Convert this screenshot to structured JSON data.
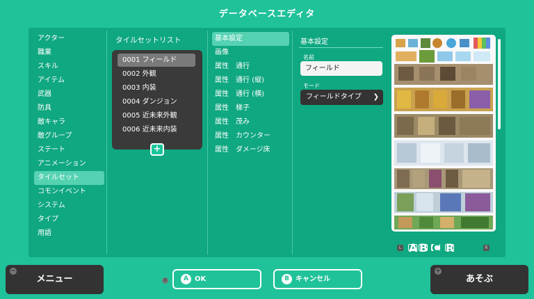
{
  "header": {
    "title": "データベースエディタ"
  },
  "categories": [
    "アクター",
    "職業",
    "スキル",
    "アイテム",
    "武器",
    "防具",
    "敵キャラ",
    "敵グループ",
    "ステート",
    "アニメーション",
    "タイルセット",
    "コモンイベント",
    "システム",
    "タイプ",
    "用語"
  ],
  "selected_category": "タイルセット",
  "tileset_list": {
    "title": "タイルセットリスト",
    "items": [
      "0001 フィールド",
      "0002 外観",
      "0003 内装",
      "0004 ダンジョン",
      "0005 近未来外観",
      "0006 近未来内装"
    ],
    "selected": "0001 フィールド",
    "add_label": "+"
  },
  "sections": [
    "基本設定",
    "画像",
    "属性　通行",
    "属性　通行 (縦)",
    "属性　通行 (横)",
    "属性　梯子",
    "属性　茂み",
    "属性　カウンター",
    "属性　ダメージ床"
  ],
  "settings": {
    "title": "基本設定",
    "name_label": "名前",
    "name_value": "フィールド",
    "mode_label": "モード",
    "mode_value": "フィールドタイプ"
  },
  "tile_tabs": {
    "left_key": "L",
    "right_key": "R",
    "tabs": [
      "A",
      "B",
      "C",
      "R"
    ],
    "selected": "C"
  },
  "footer": {
    "menu_label": "メニュー",
    "menu_badge": "−",
    "ok_key": "A",
    "ok_label": "OK",
    "cancel_key": "B",
    "cancel_label": "キャンセル",
    "play_label": "あそぶ",
    "play_badge": "+",
    "x_key": "X"
  },
  "colors": {
    "background": "#20c29a",
    "panel": "#0fa880",
    "dark": "#333333"
  }
}
